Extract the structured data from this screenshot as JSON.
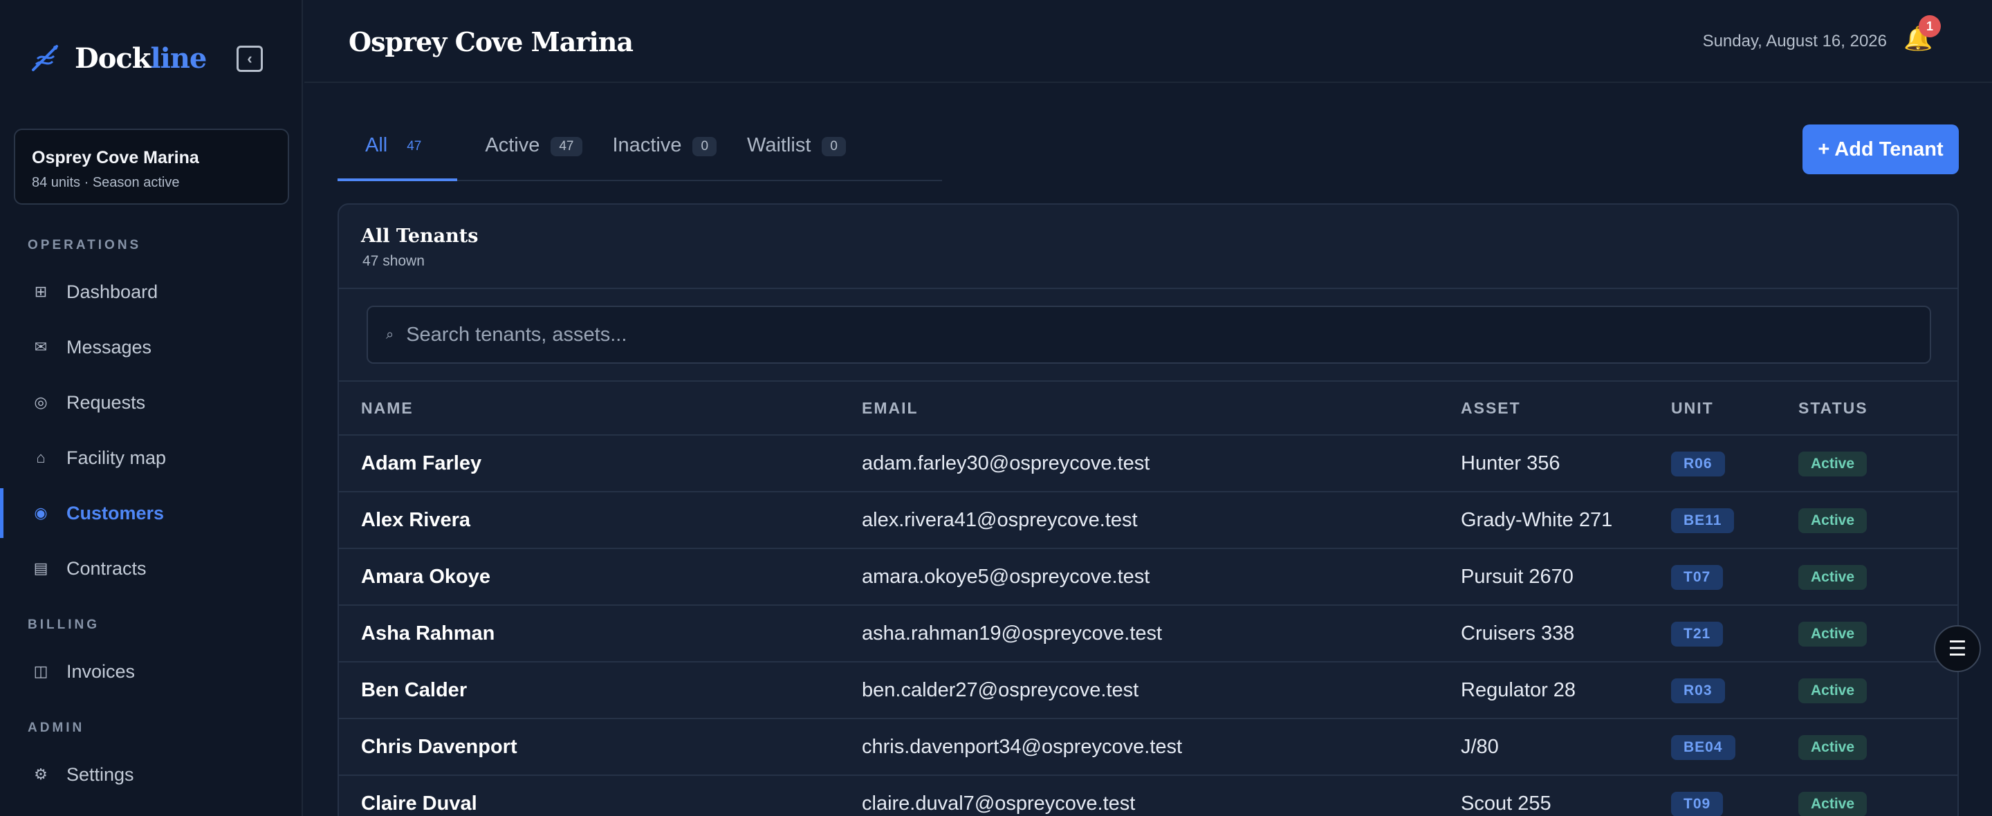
{
  "brand": {
    "name_main": "Dock",
    "name_accent": "line"
  },
  "marina": {
    "name": "Osprey Cove Marina",
    "meta": "84 units · Season active"
  },
  "sidebar": {
    "sections": [
      {
        "label": "OPERATIONS"
      },
      {
        "label": "BILLING"
      },
      {
        "label": "ADMIN"
      }
    ],
    "items": [
      {
        "label": "Dashboard",
        "icon": "grid-icon",
        "glyph": "⊞"
      },
      {
        "label": "Messages",
        "icon": "envelope-icon",
        "glyph": "✉"
      },
      {
        "label": "Requests",
        "icon": "lifebuoy-icon",
        "glyph": "◎"
      },
      {
        "label": "Facility map",
        "icon": "home-icon",
        "glyph": "⌂"
      },
      {
        "label": "Customers",
        "icon": "customers-icon",
        "glyph": "◉"
      },
      {
        "label": "Contracts",
        "icon": "document-icon",
        "glyph": "▤"
      },
      {
        "label": "Invoices",
        "icon": "invoice-icon",
        "glyph": "◫"
      },
      {
        "label": "Settings",
        "icon": "gear-icon",
        "glyph": "⚙"
      }
    ]
  },
  "header": {
    "title": "Osprey Cove Marina",
    "date": "Sunday, August 16, 2026",
    "notifications": "1"
  },
  "tabs": [
    {
      "label": "All",
      "count": "47"
    },
    {
      "label": "Active",
      "count": "47"
    },
    {
      "label": "Inactive",
      "count": "0"
    },
    {
      "label": "Waitlist",
      "count": "0"
    }
  ],
  "add_button": "+ Add Tenant",
  "table": {
    "title": "All Tenants",
    "subtitle": "47 shown",
    "search_placeholder": "Search tenants, assets...",
    "columns": [
      "NAME",
      "EMAIL",
      "ASSET",
      "UNIT",
      "STATUS"
    ],
    "rows": [
      {
        "name": "Adam Farley",
        "email": "adam.farley30@ospreycove.test",
        "asset": "Hunter 356",
        "unit": "R06",
        "status": "Active"
      },
      {
        "name": "Alex Rivera",
        "email": "alex.rivera41@ospreycove.test",
        "asset": "Grady-White 271",
        "unit": "BE11",
        "status": "Active"
      },
      {
        "name": "Amara Okoye",
        "email": "amara.okoye5@ospreycove.test",
        "asset": "Pursuit 2670",
        "unit": "T07",
        "status": "Active"
      },
      {
        "name": "Asha Rahman",
        "email": "asha.rahman19@ospreycove.test",
        "asset": "Cruisers 338",
        "unit": "T21",
        "status": "Active"
      },
      {
        "name": "Ben Calder",
        "email": "ben.calder27@ospreycove.test",
        "asset": "Regulator 28",
        "unit": "R03",
        "status": "Active"
      },
      {
        "name": "Chris Davenport",
        "email": "chris.davenport34@ospreycove.test",
        "asset": "J/80",
        "unit": "BE04",
        "status": "Active"
      },
      {
        "name": "Claire Duval",
        "email": "claire.duval7@ospreycove.test",
        "asset": "Scout 255",
        "unit": "T09",
        "status": "Active"
      }
    ]
  },
  "colors": {
    "accent": "#3f7cf4",
    "background": "#111a2b",
    "sidebar": "#0f1726",
    "status_active": "#6fd1b7"
  }
}
